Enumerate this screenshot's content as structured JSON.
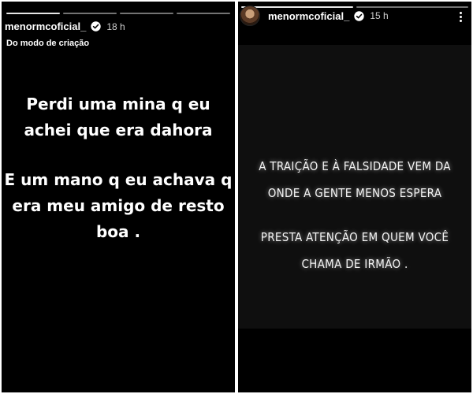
{
  "left_story": {
    "username": "menormcoficial_",
    "time": "18 h",
    "subtitle": "Do modo de criação",
    "paragraph1": [
      "Perdi uma mina q eu",
      "achei que era dahora"
    ],
    "paragraph2": [
      "E um mano q eu achava q",
      "era meu amigo de resto",
      "boa ."
    ]
  },
  "right_story": {
    "username": "menormcoficial_",
    "time": "15 h",
    "paragraph1": [
      "A TRAIÇÃO E À FALSIDADE VEM DA",
      "ONDE A GENTE MENOS ESPERA"
    ],
    "paragraph2": [
      "PRESTA ATENÇÃO EM QUEM VOCÊ",
      "CHAMA DE IRMÃO ."
    ]
  },
  "icons": {
    "verified": "verified-badge-icon",
    "more": "more-options-icon",
    "avatar": "profile-avatar"
  },
  "colors": {
    "story_background": "#000000",
    "panel_background": "#0f0f0f",
    "text": "#ffffff",
    "verified_badge": "#ffffff"
  }
}
